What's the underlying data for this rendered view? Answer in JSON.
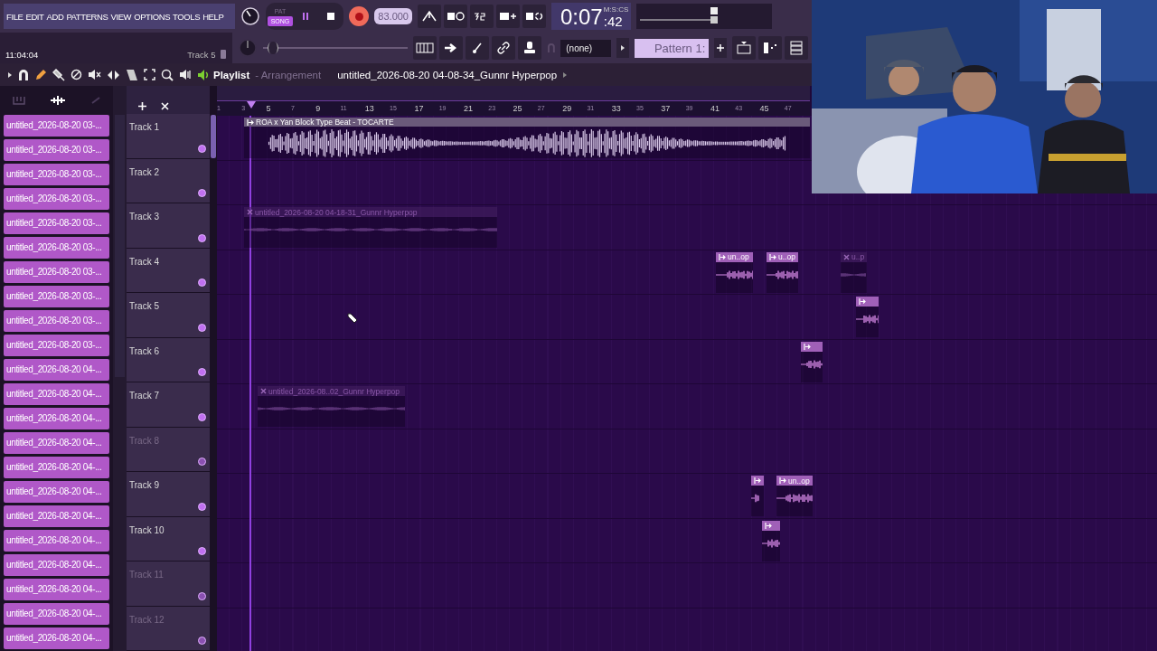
{
  "menu": [
    "FILE",
    "EDIT",
    "ADD",
    "PATTERNS",
    "VIEW",
    "OPTIONS",
    "TOOLS",
    "HELP"
  ],
  "hint": {
    "time": "11:04:04",
    "target": "Track 5"
  },
  "mode_toggle": [
    {
      "label": "PAT",
      "selected": false
    },
    {
      "label": "SONG",
      "selected": true
    }
  ],
  "transport": {
    "record_armed": true
  },
  "tempo": "83.000",
  "pitch": {
    "level": 0.04
  },
  "clock": {
    "units": "M:S:CS",
    "main": "0:07",
    "fraction": ":42"
  },
  "pattern_picker": {
    "channel": "(none)",
    "pattern": "Pattern 1:"
  },
  "playlist": {
    "title": "Playlist",
    "view": "- Arrangement",
    "project": "untitled_2026-08-20 04-08-34_Gunnr Hyperpop"
  },
  "browser": [
    "untitled_2026-08-20 03-...",
    "untitled_2026-08-20 03-...",
    "untitled_2026-08-20 03-...",
    "untitled_2026-08-20 03-...",
    "untitled_2026-08-20 03-...",
    "untitled_2026-08-20 03-...",
    "untitled_2026-08-20 03-...",
    "untitled_2026-08-20 03-...",
    "untitled_2026-08-20 03-...",
    "untitled_2026-08-20 03-...",
    "untitled_2026-08-20 04-...",
    "untitled_2026-08-20 04-...",
    "untitled_2026-08-20 04-...",
    "untitled_2026-08-20 04-...",
    "untitled_2026-08-20 04-...",
    "untitled_2026-08-20 04-...",
    "untitled_2026-08-20 04-...",
    "untitled_2026-08-20 04-...",
    "untitled_2026-08-20 04-...",
    "untitled_2026-08-20 04-...",
    "untitled_2026-08-20 04-...",
    "untitled_2026-08-20 04-..."
  ],
  "ruler": [
    "1",
    "3",
    "5",
    "7",
    "9",
    "11",
    "13",
    "15",
    "17",
    "19",
    "21",
    "23",
    "25",
    "27",
    "29",
    "31",
    "33",
    "35",
    "37",
    "39",
    "41",
    "43",
    "45",
    "47"
  ],
  "tracks": [
    {
      "name": "Track 1",
      "muted": false,
      "clips": [
        {
          "label": "ROA x Yan Block Type Beat - TOCARTE",
          "muted": false
        }
      ]
    },
    {
      "name": "Track 2",
      "muted": false
    },
    {
      "name": "Track 3",
      "muted": false,
      "clips": [
        {
          "label": "untitled_2026-08-20 04-18-31_Gunnr Hyperpop",
          "muted": true
        }
      ]
    },
    {
      "name": "Track 4",
      "muted": false,
      "clips": [
        {
          "label": "un..op",
          "muted": false
        },
        {
          "label": "u..op",
          "muted": false
        },
        {
          "label": "u..p",
          "muted": true
        }
      ]
    },
    {
      "name": "Track 5",
      "muted": false,
      "clips": [
        {
          "muted": false
        }
      ]
    },
    {
      "name": "Track 6",
      "muted": false,
      "clips": [
        {
          "muted": false
        }
      ]
    },
    {
      "name": "Track 7",
      "muted": false,
      "clips": [
        {
          "label": "untitled_2026-08..02_Gunnr Hyperpop",
          "muted": true
        }
      ]
    },
    {
      "name": "Track 8",
      "muted": true
    },
    {
      "name": "Track 9",
      "muted": false,
      "clips": [
        {
          "muted": false
        },
        {
          "label": "un..op",
          "muted": false
        }
      ]
    },
    {
      "name": "Track 10",
      "muted": false,
      "clips": [
        {
          "muted": false
        }
      ]
    },
    {
      "name": "Track 11",
      "muted": true
    },
    {
      "name": "Track 12",
      "muted": true
    }
  ]
}
